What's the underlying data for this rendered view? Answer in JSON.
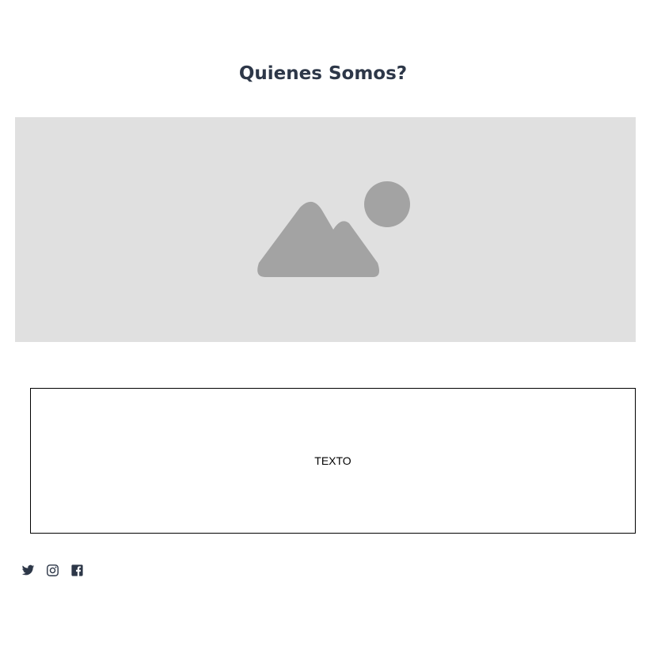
{
  "section": {
    "title": "Quienes Somos?"
  },
  "hero": {
    "icon": "image-placeholder-icon",
    "background": "#e0e0e0",
    "icon_color": "#a3a3a3"
  },
  "content": {
    "text": "TEXTO"
  },
  "social": {
    "icon_color": "#2d3748",
    "items": [
      {
        "icon": "twitter-icon"
      },
      {
        "icon": "instagram-icon"
      },
      {
        "icon": "facebook-icon"
      }
    ]
  }
}
